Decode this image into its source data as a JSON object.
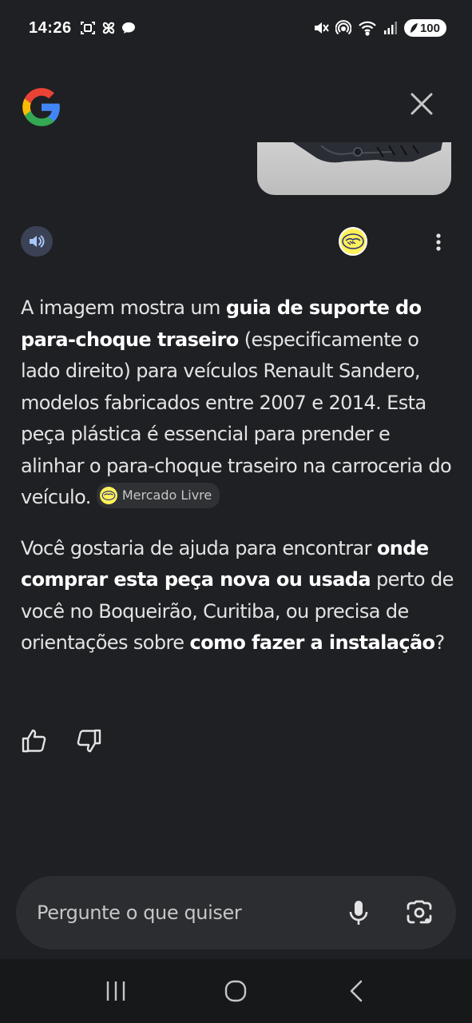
{
  "status_bar": {
    "time": "14:26",
    "battery": "100"
  },
  "response": {
    "p1_t1": "A imagem mostra um ",
    "p1_b1": "guia de suporte do para-choque traseiro",
    "p1_t2": " (especificamente o lado direito) para veículos Renault Sandero, modelos fabricados entre 2007 e 2014. Esta peça plástica é essencial para prender e alinhar o para-choque traseiro na carroceria do veículo.",
    "source_chip": "Mercado Livre",
    "p2_t1": "Você gostaria de ajuda para encontrar ",
    "p2_b1": "onde comprar esta peça nova ou usada",
    "p2_t2": " perto de você no Boqueirão, Curitiba, ou precisa de orientações sobre ",
    "p2_b2": "como fazer a instalação",
    "p2_t3": "?"
  },
  "input": {
    "placeholder": "Pergunte o que quiser"
  },
  "icons": {
    "status": [
      "face-scan-icon",
      "pinwheel-icon",
      "chat-bubble-icon",
      "mute-icon",
      "hotspot-icon",
      "wifi-icon",
      "signal-icon",
      "battery-icon"
    ],
    "header": [
      "google-logo",
      "close-icon"
    ],
    "actions": [
      "speaker-icon",
      "mercado-livre-logo",
      "more-vert-icon"
    ],
    "feedback": [
      "thumbs-up-icon",
      "thumbs-down-icon"
    ],
    "input": [
      "mic-icon",
      "lens-icon"
    ],
    "nav": [
      "recents-icon",
      "home-icon",
      "back-icon"
    ]
  },
  "colors": {
    "background": "#1f2023",
    "text": "#e3e3e3",
    "speaker_bg": "#3b4255",
    "input_bg": "#2c2d30",
    "nav_bg": "#17181a",
    "mercado_livre_yellow": "#fff159"
  }
}
